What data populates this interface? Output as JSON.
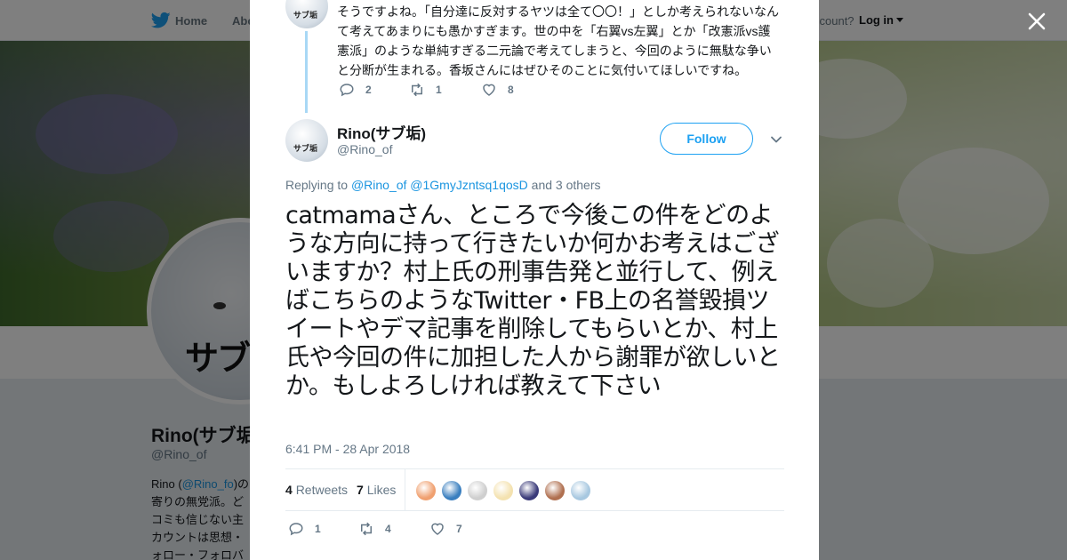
{
  "nav": {
    "home": "Home",
    "about": "Abo",
    "account_prompt": "ccount?",
    "login": "Log in"
  },
  "profile": {
    "name": "Rino(サブ垢",
    "handle": "@Rino_of",
    "bio_prefix": "Rino (",
    "bio_link": "@Rino_fo",
    "bio_suffix": ")の",
    "bio_lines": [
      "寄りの無党派。ど",
      "コミも信じない主",
      "カウントは思想・",
      "ォロー・フォロバ"
    ],
    "avatar_text": "サブ"
  },
  "prev_tweet": {
    "avatar_label": "サブ垢",
    "text": "そうですよね。「自分達に反対するヤツは全て〇〇！」としか考えられないなんて考えてあまりにも愚かすぎます。世の中を「右翼vs左翼」とか「改憲派vs護憲派」のような単純すぎる二元論で考えてしまうと、今回のように無駄な争いと分断が生まれる。香坂さんにはぜひそのことに気付いてほしいですね。",
    "replies": "2",
    "retweets": "1",
    "likes": "8"
  },
  "tweet": {
    "author_name": "Rino(サブ垢)",
    "author_handle": "@Rino_of",
    "avatar_label": "サブ垢",
    "follow_label": "Follow",
    "replying_prefix": "Replying to ",
    "replying_user_1": "@Rino_of",
    "replying_user_2": "@1GmyJzntsq1qosD",
    "replying_suffix": " and 3 others",
    "text": "catmamaさん、ところで今後この件をどのような方向に持って行きたいか何かお考えはございますか？村上氏の刑事告発と並行して、例えばこちらのようなTwitter・FB上の名誉毀損ツイートやデマ記事を削除してもらいとか、村上氏や今回の件に加担した人から謝罪が欲しいとか。もしよろしければ教えて下さい",
    "timestamp": "6:41 PM - 28 Apr 2018",
    "retweet_count": "4",
    "retweet_label": "Retweets",
    "like_count": "7",
    "like_label": "Likes",
    "replies": "1",
    "retweets": "4",
    "likes": "7",
    "liker_colors": [
      "#f0a070",
      "#3a7fbf",
      "#cfcfcf",
      "#f4e2b0",
      "#3b3b7a",
      "#b07050",
      "#a8c8e0"
    ]
  },
  "colors": {
    "accent": "#1da1f2",
    "link": "#1b95e0",
    "muted": "#657786"
  },
  "icons": [
    "twitter-bird-icon",
    "close-icon",
    "reply-icon",
    "retweet-icon",
    "like-icon",
    "chevron-down-icon"
  ]
}
